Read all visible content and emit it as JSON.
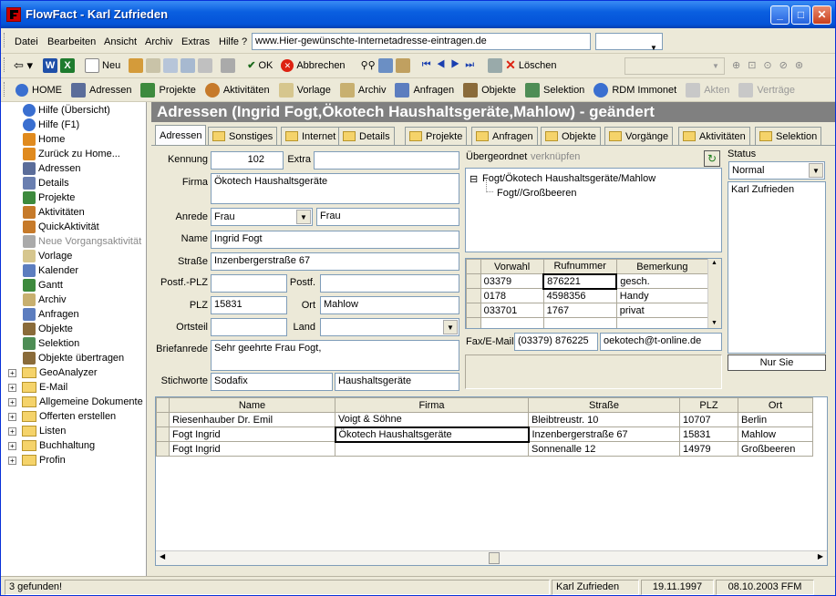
{
  "window": {
    "title": "FlowFact - Karl Zufrieden"
  },
  "menu": {
    "items": [
      "Datei",
      "Bearbeiten",
      "Ansicht",
      "Archiv",
      "Extras",
      "Hilfe ?"
    ],
    "url_value": "www.Hier-gewünschte-Internetadresse-eintragen.de"
  },
  "toolbar1": {
    "neu": "Neu",
    "ok": "OK",
    "abbrechen": "Abbrechen",
    "loeschen": "Löschen"
  },
  "toolbar2": {
    "items": [
      "HOME",
      "Adressen",
      "Projekte",
      "Aktivitäten",
      "Vorlage",
      "Archiv",
      "Anfragen",
      "Objekte",
      "Selektion",
      "RDM Immonet",
      "Akten",
      "Verträge"
    ]
  },
  "sidebar": {
    "items": [
      "Hilfe (Übersicht)",
      "Hilfe (F1)",
      "Home",
      "Zurück zu Home...",
      "Adressen",
      "Details",
      "Projekte",
      "Aktivitäten",
      "QuickAktivität",
      "Neue Vorgangsaktivität",
      "Vorlage",
      "Kalender",
      "Gantt",
      "Archiv",
      "Anfragen",
      "Objekte",
      "Selektion",
      "Objekte übertragen"
    ],
    "folders": [
      "GeoAnalyzer",
      "E-Mail",
      "Allgemeine Dokumente",
      "Offerten erstellen",
      "Listen",
      "Buchhaltung",
      "Profin"
    ]
  },
  "main": {
    "banner": "Adressen (Ingrid Fogt,Ökotech Haushaltsgeräte,Mahlow) - geändert",
    "tabs": [
      "Adressen",
      "Sonstiges",
      "Internet",
      "Details",
      "Projekte",
      "Anfragen",
      "Objekte",
      "Vorgänge",
      "Aktivitäten",
      "Selektion"
    ]
  },
  "form": {
    "kennung_label": "Kennung",
    "kennung": "102",
    "extra_label": "Extra",
    "firma_label": "Firma",
    "firma": "Ökotech Haushaltsgeräte",
    "anrede_label": "Anrede",
    "anrede": "Frau",
    "anrede2": "Frau",
    "name_label": "Name",
    "name": "Ingrid Fogt",
    "strasse_label": "Straße",
    "strasse": "Inzenbergerstraße 67",
    "postfplz_label": "Postf.-PLZ",
    "postf_label": "Postf.",
    "plz_label": "PLZ",
    "plz": "15831",
    "ort_label": "Ort",
    "ort": "Mahlow",
    "ortsteil_label": "Ortsteil",
    "land_label": "Land",
    "briefanrede_label": "Briefanrede",
    "briefanrede": "Sehr geehrte Frau Fogt,",
    "stichworte_label": "Stichworte",
    "stichwort1": "Sodafix",
    "stichwort2": "Haushaltsgeräte"
  },
  "uebergeordnet": {
    "label": "Übergeordnet",
    "link": "verknüpfen",
    "tree": [
      "Fogt/Ökotech Haushaltsgeräte/Mahlow",
      "Fogt//Großbeeren"
    ]
  },
  "phones": {
    "headers": [
      "Vorwahl",
      "Rufnummer",
      "Bemerkung"
    ],
    "rows": [
      [
        "03379",
        "876221",
        "gesch."
      ],
      [
        "0178",
        "4598356",
        "Handy"
      ],
      [
        "033701",
        "1767",
        "privat"
      ]
    ]
  },
  "fax": {
    "label": "Fax/E-Mail",
    "fax": "(03379)  876225",
    "email": "oekotech@t-online.de"
  },
  "status_panel": {
    "label": "Status",
    "value": "Normal",
    "user": "Karl Zufrieden",
    "button": "Nur Sie"
  },
  "results": {
    "headers": [
      "Name",
      "Firma",
      "Straße",
      "PLZ",
      "Ort"
    ],
    "rows": [
      [
        "Riesenhauber Dr. Emil",
        "Voigt & Söhne",
        "Bleibtreustr. 10",
        "10707",
        "Berlin"
      ],
      [
        "Fogt Ingrid",
        "Ökotech Haushaltsgeräte",
        "Inzenbergerstraße 67",
        "15831",
        "Mahlow"
      ],
      [
        "Fogt Ingrid",
        "",
        "Sonnenalle 12",
        "14979",
        "Großbeeren"
      ]
    ]
  },
  "statusbar": {
    "found": "3 gefunden!",
    "user": "Karl Zufrieden",
    "date1": "19.11.1997",
    "date2": "08.10.2003 FFM"
  }
}
